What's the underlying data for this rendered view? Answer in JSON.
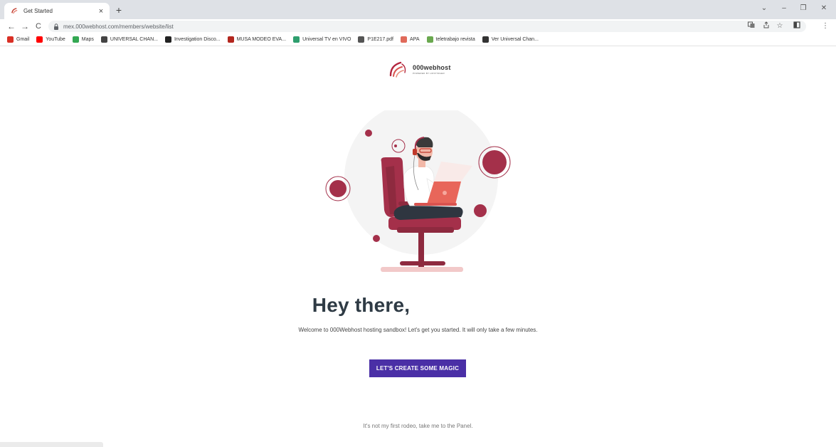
{
  "browser": {
    "tab": {
      "title": "Get Started",
      "close_icon": "close-icon"
    },
    "new_tab_label": "+",
    "window_controls": {
      "minimize": "–",
      "restore": "❐",
      "close": "✕",
      "tab_search": "⌄"
    },
    "address": "mex.000webhost.com/members/website/list",
    "nav": {
      "back": "←",
      "forward": "→",
      "reload": "C"
    },
    "bookmarks": [
      {
        "label": "Gmail",
        "icon": "gmail-icon",
        "color": "#d93025"
      },
      {
        "label": "YouTube",
        "icon": "youtube-icon",
        "color": "#ff0000"
      },
      {
        "label": "Maps",
        "icon": "maps-icon",
        "color": "#34a853"
      },
      {
        "label": "UNIVERSAL CHAN...",
        "icon": "globe-icon",
        "color": "#444444"
      },
      {
        "label": "Investigation Disco...",
        "icon": "tv-icon",
        "color": "#222222"
      },
      {
        "label": "MUSA MODEO EVA...",
        "icon": "musa-icon",
        "color": "#b3261e"
      },
      {
        "label": "Universal TV en VIVO",
        "icon": "universal-icon",
        "color": "#2e9e6e"
      },
      {
        "label": "P1E217.pdf",
        "icon": "pdf-icon",
        "color": "#555555"
      },
      {
        "label": "APA",
        "icon": "apa-icon",
        "color": "#e06a5a"
      },
      {
        "label": "teletrabajo revista",
        "icon": "sheet-icon",
        "color": "#6aa84f"
      },
      {
        "label": "Ver Universal Chan...",
        "icon": "globe-dark-icon",
        "color": "#333333"
      }
    ]
  },
  "logo": {
    "brand": "000webhost",
    "sub": "POWERED BY HOSTINGER"
  },
  "main": {
    "heading": "Hey there,",
    "subtitle": "Welcome to 000Webhost hosting sandbox! Let's get you started. It will only take a few minutes.",
    "cta_label": "LET'S CREATE SOME MAGIC",
    "panel_link": "It's not my first rodeo, take me to the Panel."
  },
  "colors": {
    "brand_red": "#a4304a",
    "cta_purple": "#4a2fa6",
    "heading": "#2f3b45"
  }
}
